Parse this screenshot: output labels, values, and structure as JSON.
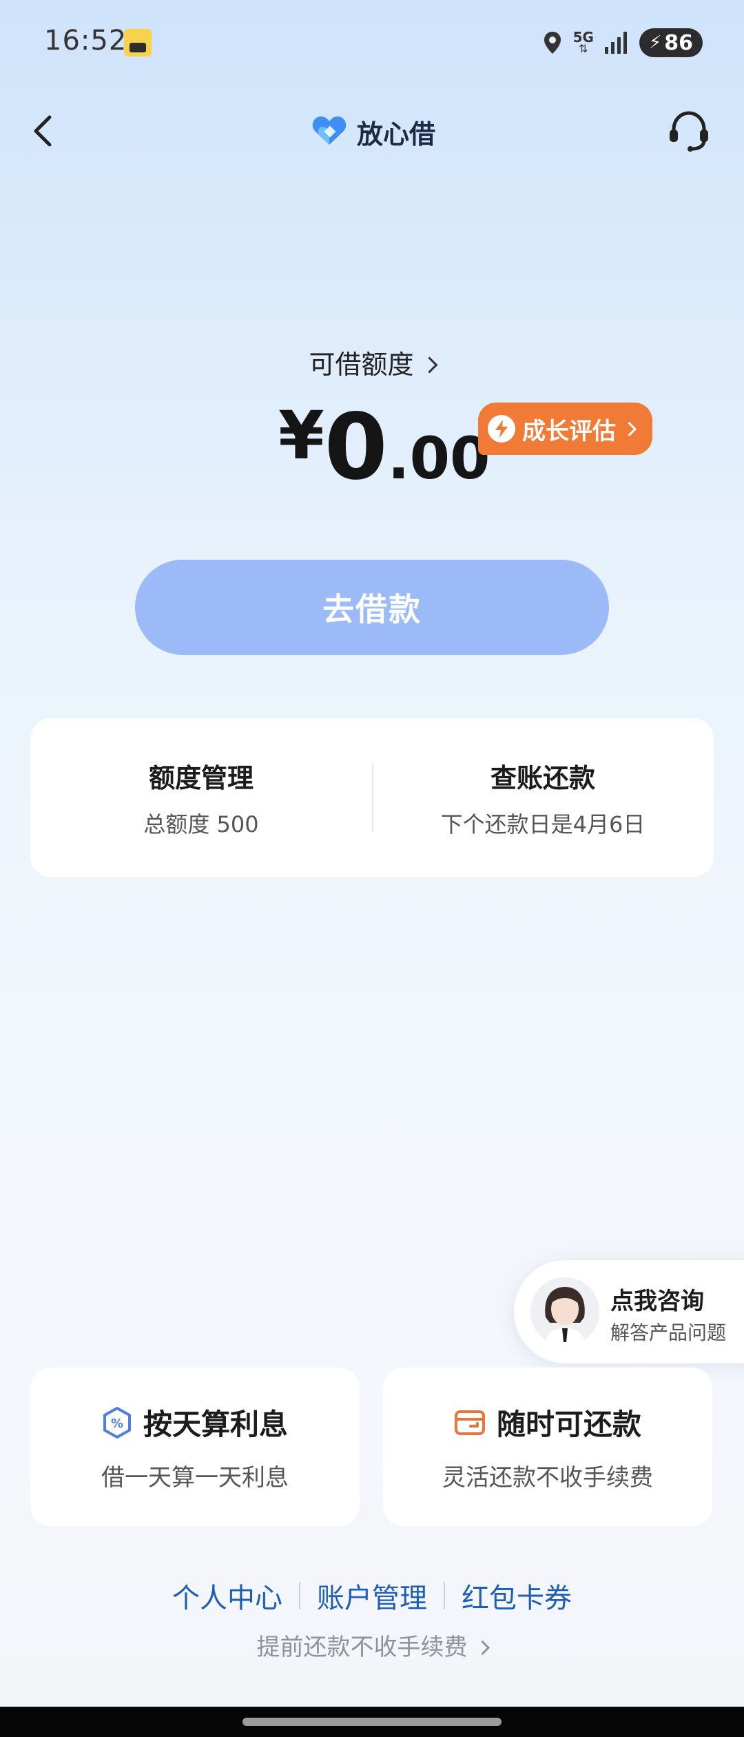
{
  "status_bar": {
    "time": "16:52",
    "network": "5G",
    "battery": "86",
    "icons": [
      "app-notification-icon",
      "location-icon",
      "network-5g-icon",
      "signal-icon",
      "battery-icon"
    ]
  },
  "nav": {
    "title": "放心借",
    "back_icon": "back-chevron-icon",
    "service_icon": "headset-icon"
  },
  "credit": {
    "label": "可借额度",
    "currency": "¥",
    "amount_int": "0",
    "amount_dec": ".00",
    "growth_badge": "成长评估"
  },
  "borrow_button": "去借款",
  "manage_card": {
    "left": {
      "title": "额度管理",
      "sub": "总额度 500"
    },
    "right": {
      "title": "查账还款",
      "sub": "下个还款日是4月6日"
    }
  },
  "consult": {
    "title": "点我咨询",
    "sub": "解答产品问题"
  },
  "features": [
    {
      "title": "按天算利息",
      "sub": "借一天算一天利息",
      "icon": "percent-hexagon-icon"
    },
    {
      "title": "随时可还款",
      "sub": "灵活还款不收手续费",
      "icon": "wallet-icon"
    }
  ],
  "footer": {
    "links": [
      "个人中心",
      "账户管理",
      "红包卡券"
    ],
    "note": "提前还款不收手续费"
  },
  "colors": {
    "accent_blue": "#9cb9f8",
    "badge_orange": "#f07a36",
    "link_blue": "#1d5fb8"
  }
}
